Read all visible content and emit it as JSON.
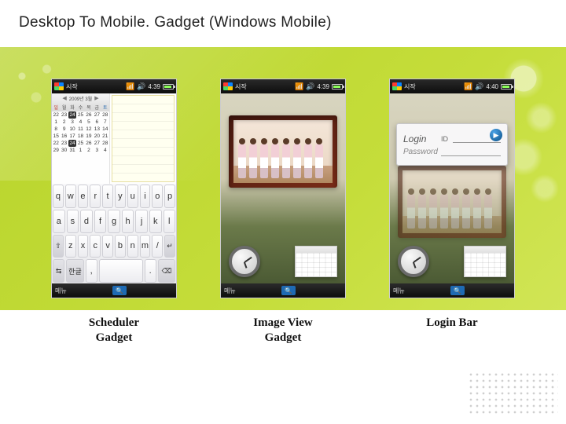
{
  "slide": {
    "title": "Desktop To Mobile. Gadget (Windows Mobile)"
  },
  "status": {
    "start": "시작",
    "time1": "4:39",
    "time2": "4:39",
    "time3": "4:40"
  },
  "softbar": {
    "left": "메뉴",
    "mid": "🔍"
  },
  "scheduler": {
    "month_label": "2009년 3월",
    "dow": [
      "일",
      "월",
      "화",
      "수",
      "목",
      "금",
      "토"
    ],
    "weeks": [
      [
        "22",
        "23",
        "24",
        "25",
        "26",
        "27",
        "28"
      ],
      [
        "1",
        "2",
        "3",
        "4",
        "5",
        "6",
        "7"
      ],
      [
        "8",
        "9",
        "10",
        "11",
        "12",
        "13",
        "14"
      ],
      [
        "15",
        "16",
        "17",
        "18",
        "19",
        "20",
        "21"
      ],
      [
        "22",
        "23",
        "24",
        "25",
        "26",
        "27",
        "28"
      ],
      [
        "29",
        "30",
        "31",
        "1",
        "2",
        "3",
        "4"
      ]
    ],
    "today": "24"
  },
  "keyboard": {
    "r1": [
      "q",
      "w",
      "e",
      "r",
      "t",
      "y",
      "u",
      "i",
      "o",
      "p"
    ],
    "r2": [
      "a",
      "s",
      "d",
      "f",
      "g",
      "h",
      "j",
      "k",
      "l"
    ],
    "r3_shift": "⇧",
    "r3": [
      "z",
      "x",
      "c",
      "v",
      "b",
      "n",
      "m",
      "/"
    ],
    "r3_enter": "↵",
    "r4_sym": "⇆",
    "r4_lang": "한글",
    "r4_punct": ",",
    "r4_space": " ",
    "r4_dot": ".",
    "r4_back": "⌫"
  },
  "login": {
    "title_label": "Login",
    "id_label": "ID",
    "pw_label": "Password",
    "go_glyph": "▶"
  },
  "captions": {
    "c1a": "Scheduler",
    "c1b": "Gadget",
    "c2a": "Image View",
    "c2b": "Gadget",
    "c3": "Login Bar"
  }
}
